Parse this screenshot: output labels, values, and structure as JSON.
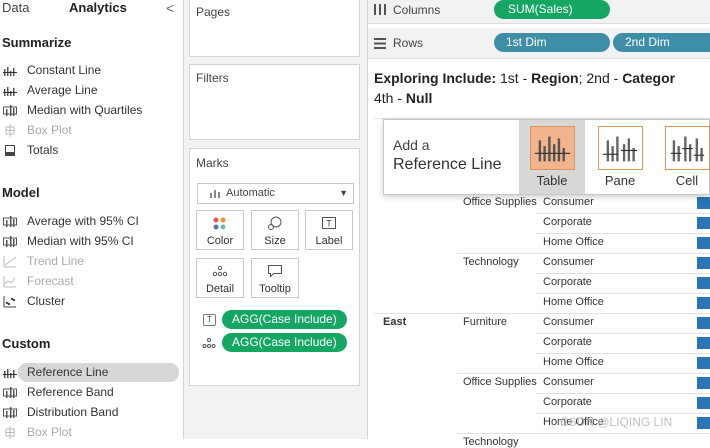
{
  "left_panel": {
    "tabs": {
      "data": "Data",
      "analytics": "Analytics",
      "collapse": "<"
    },
    "sections": [
      {
        "title": "Summarize",
        "items": [
          {
            "label": "Constant Line",
            "enabled": true
          },
          {
            "label": "Average Line",
            "enabled": true
          },
          {
            "label": "Median with Quartiles",
            "enabled": true
          },
          {
            "label": "Box Plot",
            "enabled": false
          },
          {
            "label": "Totals",
            "enabled": true
          }
        ]
      },
      {
        "title": "Model",
        "items": [
          {
            "label": "Average with 95% CI",
            "enabled": true
          },
          {
            "label": "Median with 95% CI",
            "enabled": true
          },
          {
            "label": "Trend Line",
            "enabled": false
          },
          {
            "label": "Forecast",
            "enabled": false
          },
          {
            "label": "Cluster",
            "enabled": true
          }
        ]
      },
      {
        "title": "Custom",
        "items": [
          {
            "label": "Reference Line",
            "enabled": true,
            "selected": true
          },
          {
            "label": "Reference Band",
            "enabled": true
          },
          {
            "label": "Distribution Band",
            "enabled": true
          },
          {
            "label": "Box Plot",
            "enabled": false
          }
        ]
      }
    ]
  },
  "cards": {
    "pages": "Pages",
    "filters": "Filters",
    "marks": {
      "title": "Marks",
      "type": "Automatic",
      "buttons": {
        "color": "Color",
        "size": "Size",
        "label": "Label",
        "detail": "Detail",
        "tooltip": "Tooltip"
      },
      "pills": [
        {
          "icon": "T",
          "label": "AGG(Case Include)"
        },
        {
          "icon": "detail",
          "label": "AGG(Case Include)"
        }
      ]
    }
  },
  "shelves": {
    "columns": {
      "label": "Columns",
      "pills": [
        "SUM(Sales)"
      ]
    },
    "rows": {
      "label": "Rows",
      "pills": [
        "1st Dim",
        "2nd Dim"
      ]
    }
  },
  "title": {
    "prefix": "Exploring Include:",
    "p1": " 1st - ",
    "b1": "Region",
    "p2": "; 2nd - ",
    "b2": "Categor",
    "p3": "4th - ",
    "b3": "Null"
  },
  "table": {
    "groups": [
      {
        "region": "",
        "category": "Office Supplies",
        "segments": [
          "Consumer",
          "Corporate",
          "Home Office"
        ]
      },
      {
        "region": "",
        "category": "Technology",
        "segments": [
          "Consumer",
          "Corporate",
          "Home Office"
        ]
      },
      {
        "region": "East",
        "category": "Furniture",
        "segments": [
          "Consumer",
          "Corporate",
          "Home Office"
        ]
      },
      {
        "region": "",
        "category": "Office Supplies",
        "segments": [
          "Consumer",
          "Corporate",
          "Home Office"
        ]
      }
    ],
    "partial_bottom": "Technology"
  },
  "popup": {
    "line1": "Add a",
    "line2": "Reference Line",
    "options": [
      {
        "label": "Table",
        "selected": true
      },
      {
        "label": "Pane",
        "selected": false
      },
      {
        "label": "Cell",
        "selected": false
      }
    ]
  },
  "watermark": "CSDN @LIQING LIN",
  "colors": {
    "pill_green": "#16a664",
    "pill_teal": "#3e8ea8",
    "bar_blue": "#2a75b6",
    "popup_orange": "#f2b48c"
  }
}
